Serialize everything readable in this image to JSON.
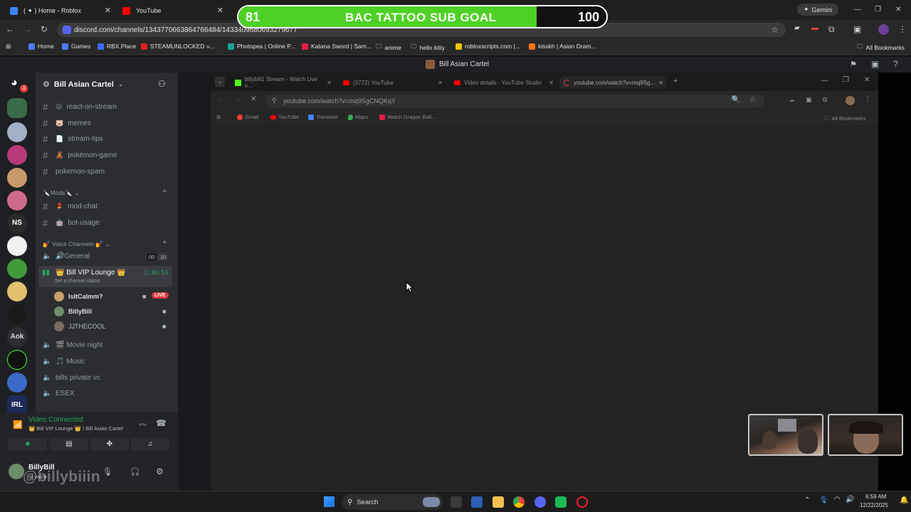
{
  "outer_tabs": [
    {
      "label": "( ✦ ) Home - Roblox",
      "color": "#3b82f6"
    },
    {
      "label": "YouTube",
      "color": "#ff0000"
    }
  ],
  "goal": {
    "left_value": "81",
    "title": "BAC TATTOO SUB GOAL",
    "right_value": "100",
    "progress": 0.81,
    "fill_color": "#4ed125"
  },
  "gemini_label": "Gemini",
  "outer_url": "discord.com/channels/1343770663864766484/1433409680693279677",
  "bookmarks": [
    {
      "label": "Home",
      "color": "#4d7cff"
    },
    {
      "label": "Games",
      "color": "#4d7cff"
    },
    {
      "label": "RBX.Place",
      "color": "#3d6bff"
    },
    {
      "label": "STEAMUNLOCKED »...",
      "color": "#e02020"
    },
    {
      "label": "Photopea | Online P...",
      "color": "#18a497"
    },
    {
      "label": "Katana Sword | Sam...",
      "color": "#e11d48"
    },
    {
      "label": "anime",
      "color": ""
    },
    {
      "label": "hello kitty",
      "color": ""
    },
    {
      "label": "robloxscripts.com |...",
      "color": "#f5c400"
    },
    {
      "label": "kisskh | Asian Dram...",
      "color": "#f97316"
    }
  ],
  "all_bookmarks": "All Bookmarks",
  "discord": {
    "window_title": "Bill Asian Cartel",
    "server_name": "Bill Asian Cartel",
    "notification_count": "3",
    "text_channels": [
      {
        "name": "react-on-stream",
        "emoji": "😮"
      },
      {
        "name": "memes",
        "emoji": "🐷"
      },
      {
        "name": "stream-tips",
        "emoji": "📄"
      },
      {
        "name": "pokémon-game",
        "emoji": "🧸"
      },
      {
        "name": "pokemon-spam",
        "emoji": ""
      }
    ],
    "mods_category": "🔪Mods🔪",
    "mod_channels": [
      {
        "name": "mod-chat",
        "emoji": "💄"
      },
      {
        "name": "bot-usage",
        "emoji": "🤖"
      }
    ],
    "voice_category": "💅 Voice Channels 💅",
    "general": {
      "name": "🔊General",
      "count_a": "00",
      "count_b": "10"
    },
    "vip_lounge": {
      "name": "👑 Bill VIP Lounge 👑",
      "timer": "2:30:53",
      "status": "Set a channel status"
    },
    "members": [
      {
        "name": "IsItCalmm?",
        "live": "LIVE",
        "color": "#c8a06a"
      },
      {
        "name": "BillyBill",
        "live": "",
        "color": "#6f8d6a"
      },
      {
        "name": "JJTHECOOL",
        "live": "",
        "color": "#7a6a60"
      }
    ],
    "other_voice": [
      {
        "name": "🎬 Movie night"
      },
      {
        "name": "🎵 Music"
      },
      {
        "name": "bills private vc"
      },
      {
        "name": "ESEX"
      }
    ],
    "voice_connected": "Video Connected",
    "voice_location": "👑 Bill VIP Lounge 👑 / Bill Asian Cartel",
    "user_name": "BillyBill",
    "user_status": "In voice"
  },
  "inner_browser": {
    "tabs": [
      {
        "label": "billybill1 Stream - Watch Live o...",
        "color": "#53fc18"
      },
      {
        "label": "(3772) YouTube",
        "color": "#ff0000"
      },
      {
        "label": "Video details - YouTube Studio",
        "color": "#ff0000"
      },
      {
        "label": "youtube.com/watch?v=mq9Sg...",
        "color": "#e34848"
      }
    ],
    "url": "youtube.com/watch?v=mq9SgCNQKqY",
    "bookmarks": [
      {
        "label": "Gmail",
        "color": "#ea4335"
      },
      {
        "label": "YouTube",
        "color": "#ff0000"
      },
      {
        "label": "Translate",
        "color": "#4285f4"
      },
      {
        "label": "Maps",
        "color": "#34a853"
      },
      {
        "label": "Watch Dragon Ball...",
        "color": "#e11d48"
      }
    ],
    "all_bookmarks": "All Bookmarks"
  },
  "watermark": "@billybiiin",
  "taskbar": {
    "search_label": "Search",
    "time": "6:59 AM",
    "date": "12/22/2025"
  }
}
